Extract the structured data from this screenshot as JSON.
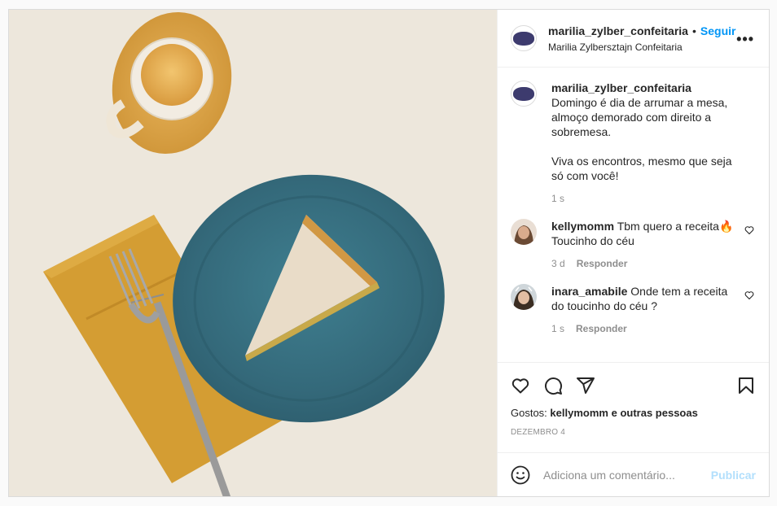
{
  "header": {
    "username": "marilia_zylber_confeitaria",
    "separator": "•",
    "follow_label": "Seguir",
    "full_name": "Marilia Zylbersztajn Confeitaria",
    "more_label": "•••",
    "avatar_icon": "bakery-logo-icon"
  },
  "caption": {
    "username": "marilia_zylber_confeitaria",
    "text": "Domingo é dia de arrumar a mesa, almoço demorado com direito a sobremesa.\n\nViva os encontros, mesmo que seja só com você!",
    "time": "1 s"
  },
  "comments": [
    {
      "username": "kellymomm",
      "text": "Tbm quero a receita🔥 Toucinho do céu",
      "time": "3 d",
      "reply_label": "Responder"
    },
    {
      "username": "inara_amabile",
      "text": "Onde tem a receita do toucinho do céu ?",
      "time": "1 s",
      "reply_label": "Responder"
    }
  ],
  "likes": {
    "prefix": "Gostos:",
    "user": "kellymomm",
    "conjunction": "e",
    "others": "outras pessoas"
  },
  "date": "DEZEMBRO 4",
  "add_comment": {
    "placeholder": "Adiciona um comentário...",
    "publish_label": "Publicar"
  },
  "colors": {
    "accent": "#0095f6",
    "publish_disabled": "#b2dffc",
    "muted": "#8e8e8e"
  },
  "icons": [
    "heart-icon",
    "comment-icon",
    "share-icon",
    "bookmark-icon",
    "emoji-icon",
    "like-small-icon"
  ]
}
